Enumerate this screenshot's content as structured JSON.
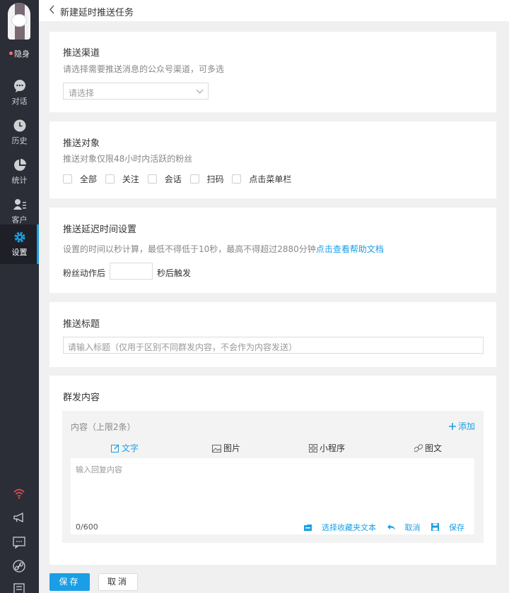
{
  "sidebar": {
    "status": "隐身",
    "items": [
      {
        "label": "对话",
        "icon": "chat-icon"
      },
      {
        "label": "历史",
        "icon": "clock-icon"
      },
      {
        "label": "统计",
        "icon": "pie-chart-icon"
      },
      {
        "label": "客户",
        "icon": "contacts-icon"
      },
      {
        "label": "设置",
        "icon": "gear-icon"
      }
    ],
    "bottom_icons": [
      "wifi-icon",
      "megaphone-icon",
      "message-icon",
      "link-icon",
      "document-icon"
    ],
    "accent_color": "#1a9fe6",
    "status_color": "#f56c6c"
  },
  "header": {
    "back_icon": "chevron-left-icon",
    "title": "新建延时推送任务"
  },
  "channel": {
    "title": "推送渠道",
    "description": "请选择需要推送消息的公众号渠道，可多选",
    "select_placeholder": "请选择"
  },
  "audience": {
    "title": "推送对象",
    "description": "推送对象仅限48小时内活跃的粉丝",
    "options": [
      "全部",
      "关注",
      "会话",
      "扫码",
      "点击菜单栏"
    ]
  },
  "delay": {
    "title": "推送延迟时间设置",
    "description": "设置的时间以秒计算，最低不得低于10秒，最高不得超过2880分钟",
    "help_link": "点击查看帮助文档",
    "prefix": "粉丝动作后",
    "suffix": "秒后触发",
    "value": ""
  },
  "push_title": {
    "title": "推送标题",
    "placeholder": "请输入标题（仅用于区别不同群发内容，不会作为内容发送）"
  },
  "mass_content": {
    "title": "群发内容",
    "content_label": "内容（上限2条）",
    "add_label": "添加",
    "tabs": [
      {
        "label": "文字",
        "icon": "edit-icon",
        "active": true
      },
      {
        "label": "图片",
        "icon": "image-icon",
        "active": false
      },
      {
        "label": "小程序",
        "icon": "grid-icon",
        "active": false
      },
      {
        "label": "图文",
        "icon": "link-icon",
        "active": false
      }
    ],
    "editor_placeholder": "输入回复内容",
    "char_count": "0/600",
    "actions": [
      "选择收藏夹文本",
      "取消",
      "保存"
    ]
  },
  "footer": {
    "save_label": "保存",
    "cancel_label": "取消"
  }
}
